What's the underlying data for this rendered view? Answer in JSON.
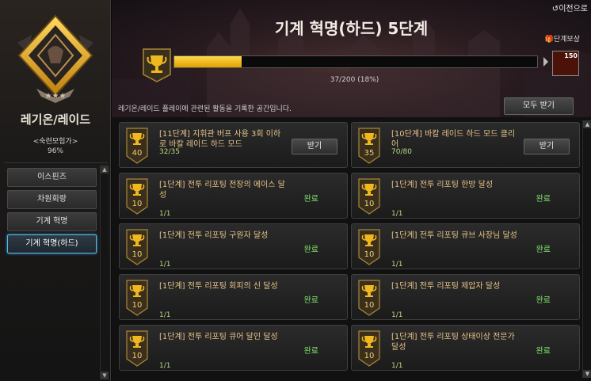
{
  "sidebar": {
    "title": "레기온/레이드",
    "subtitle": "<숙련모험가>",
    "percent": "96%",
    "items": [
      {
        "label": "이스핀즈"
      },
      {
        "label": "차원회랑"
      },
      {
        "label": "기계 혁명"
      },
      {
        "label": "기계 혁명(하드)"
      }
    ],
    "active_index": 3
  },
  "header": {
    "back_label": "이전으로",
    "title": "기계 혁명(하드) 5단계",
    "reward_label": "단계보상",
    "reward_count": "150",
    "progress_text": "37/200 (18%)",
    "progress_fraction": 0.185,
    "description": "레기온/레이드 플레이에 관련된 활동을 기록한 공간입니다.",
    "claim_all_label": "모두 받기"
  },
  "colors": {
    "accent_gold": "#f0b820",
    "progress_fill": "#f5c518",
    "complete_green": "#7ee06a",
    "active_border": "#56b8e8"
  },
  "cards": [
    {
      "points": "40",
      "title": "[11단계] 지휘관 버프 사용 3회 이하로 바칼 레이드 하드 모드",
      "progress": "32/35",
      "action": "받기",
      "state": "claim"
    },
    {
      "points": "35",
      "title": "[10단계] 바칼 레이드 하드 모드 클리어",
      "progress": "70/80",
      "action": "받기",
      "state": "claim"
    },
    {
      "points": "10",
      "title": "[1단계] 전투 리포팅 전장의 에이스 달성",
      "progress": "1/1",
      "action": "완료",
      "state": "done"
    },
    {
      "points": "10",
      "title": "[1단계] 전투 리포팅 한방 달성",
      "progress": "1/1",
      "action": "완료",
      "state": "done"
    },
    {
      "points": "10",
      "title": "[1단계] 전투 리포팅 구원자 달성",
      "progress": "1/1",
      "action": "완료",
      "state": "done"
    },
    {
      "points": "10",
      "title": "[1단계] 전투 리포팅 큐브 사장님 달성",
      "progress": "1/1",
      "action": "완료",
      "state": "done"
    },
    {
      "points": "10",
      "title": "[1단계] 전투 리포팅 회피의 신 달성",
      "progress": "1/1",
      "action": "완료",
      "state": "done"
    },
    {
      "points": "10",
      "title": "[1단계] 전투 리포팅 제압자 달성",
      "progress": "1/1",
      "action": "완료",
      "state": "done"
    },
    {
      "points": "10",
      "title": "[1단계] 전투 리포팅 큐어 달인 달성",
      "progress": "1/1",
      "action": "완료",
      "state": "done"
    },
    {
      "points": "10",
      "title": "[1단계] 전투 리포팅 상태이상 전문가 달성",
      "progress": "1/1",
      "action": "완료",
      "state": "done"
    }
  ]
}
